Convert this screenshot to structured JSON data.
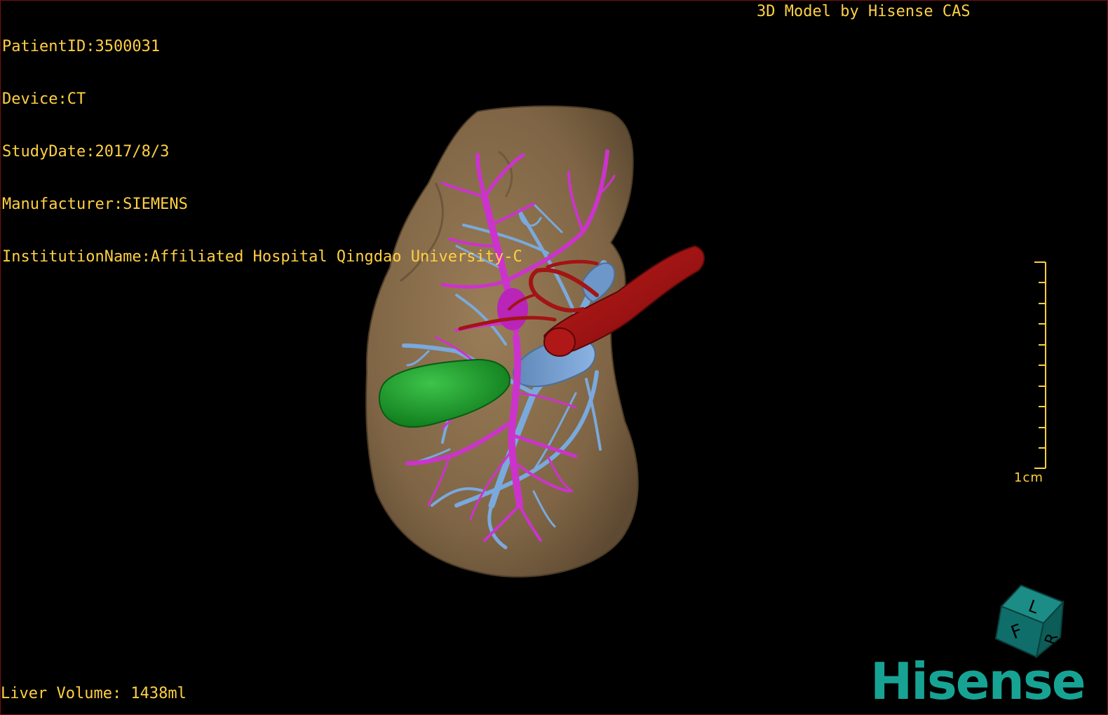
{
  "header": {
    "patient_id": "PatientID:3500031",
    "device": "Device:CT",
    "study_date": "StudyDate:2017/8/3",
    "manufacturer": "Manufacturer:SIEMENS",
    "institution": "InstitutionName:Affiliated Hospital Qingdao University-C",
    "model_title": "3D Model by Hisense CAS"
  },
  "footer": {
    "liver_volume": "Liver Volume: 1438ml"
  },
  "scale": {
    "label": "1cm",
    "color": "#ffd043"
  },
  "orientation_cube": {
    "letters": [
      "F",
      "L",
      "R"
    ],
    "color": "#0f6e6a"
  },
  "logo": {
    "text": "Hisense",
    "color": "#17a394"
  },
  "model_colors": {
    "liver": "#8a6e4c",
    "portal_vein": "#cc33cc",
    "hepatic_vein": "#7aa9dd",
    "ivc": "#6d97c8",
    "gallbladder": "#17a52a",
    "artery": "#a31414"
  }
}
